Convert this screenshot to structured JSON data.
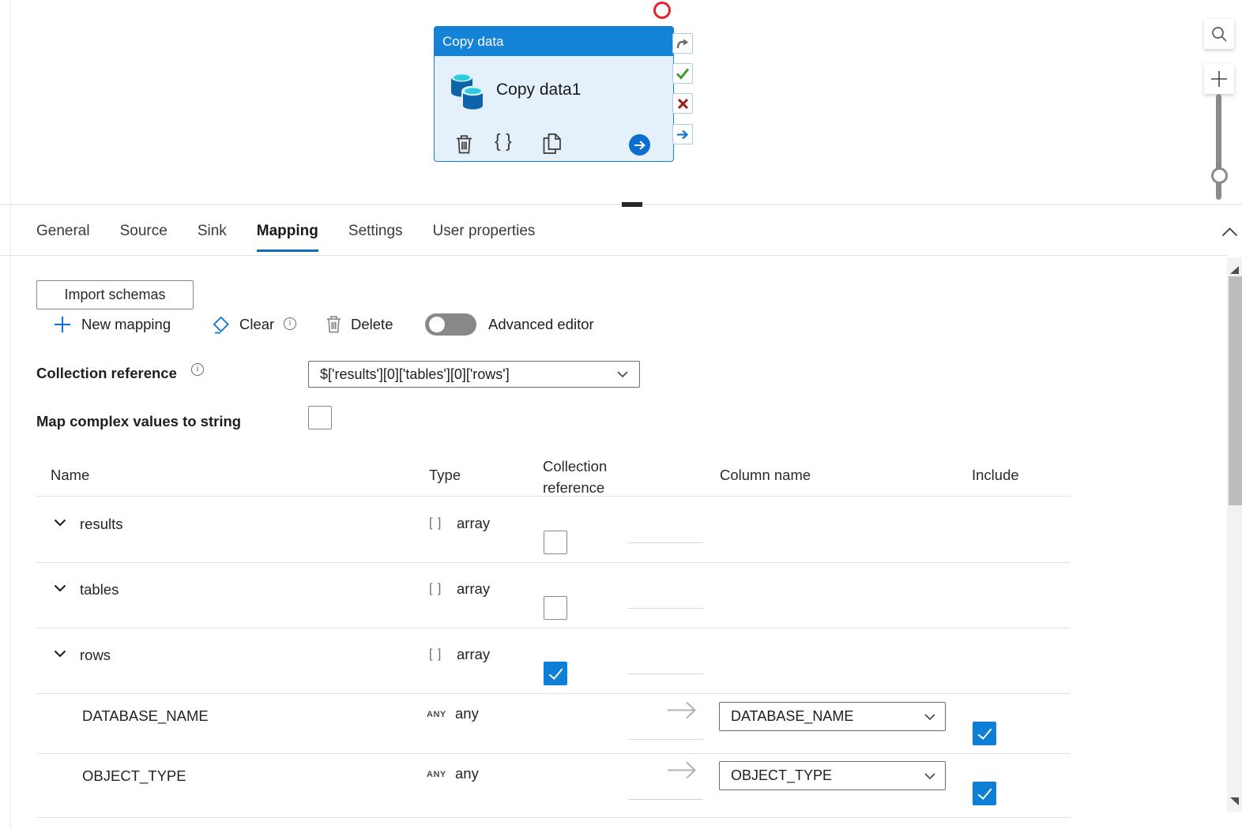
{
  "colors": {
    "accent_blue": "#1583d5",
    "tab_underline": "#0f6cbd",
    "card_body": "#e4f1fb",
    "checkbox_checked": "#0e7fd6",
    "success_green": "#3f9e2f",
    "error_red": "#9e1b1b",
    "annotation_red": "#e8212d"
  },
  "icons": {
    "braces": "{ }",
    "plus": "+"
  },
  "canvas": {
    "activity": {
      "title": "Copy data",
      "name": "Copy data1"
    }
  },
  "tabs": [
    {
      "label": "General",
      "active": false
    },
    {
      "label": "Source",
      "active": false
    },
    {
      "label": "Sink",
      "active": false
    },
    {
      "label": "Mapping",
      "active": true
    },
    {
      "label": "Settings",
      "active": false
    },
    {
      "label": "User properties",
      "active": false
    }
  ],
  "toolbar": {
    "import_schemas_label": "Import schemas",
    "new_mapping_label": "New mapping",
    "clear_label": "Clear",
    "delete_label": "Delete",
    "advanced_editor_label": "Advanced editor",
    "advanced_editor_on": false
  },
  "collection_reference": {
    "label": "Collection reference",
    "value": "$['results'][0]['tables'][0]['rows']"
  },
  "map_complex": {
    "label": "Map complex values to string",
    "checked": false
  },
  "mapping_table": {
    "headers": {
      "name": "Name",
      "type": "Type",
      "collection_reference": "Collection reference",
      "column_name": "Column name",
      "include": "Include"
    },
    "rows": [
      {
        "name": "results",
        "type": "array",
        "type_badge": "[ ]",
        "expandable": true,
        "collection_checked": false
      },
      {
        "name": "tables",
        "type": "array",
        "type_badge": "[ ]",
        "expandable": true,
        "collection_checked": false
      },
      {
        "name": "rows",
        "type": "array",
        "type_badge": "[ ]",
        "expandable": true,
        "collection_checked": true
      },
      {
        "name": "DATABASE_NAME",
        "type": "any",
        "type_badge": "ANY",
        "column_name": "DATABASE_NAME",
        "include_checked": true
      },
      {
        "name": "OBJECT_TYPE",
        "type": "any",
        "type_badge": "ANY",
        "column_name": "OBJECT_TYPE",
        "include_checked": true
      }
    ]
  }
}
